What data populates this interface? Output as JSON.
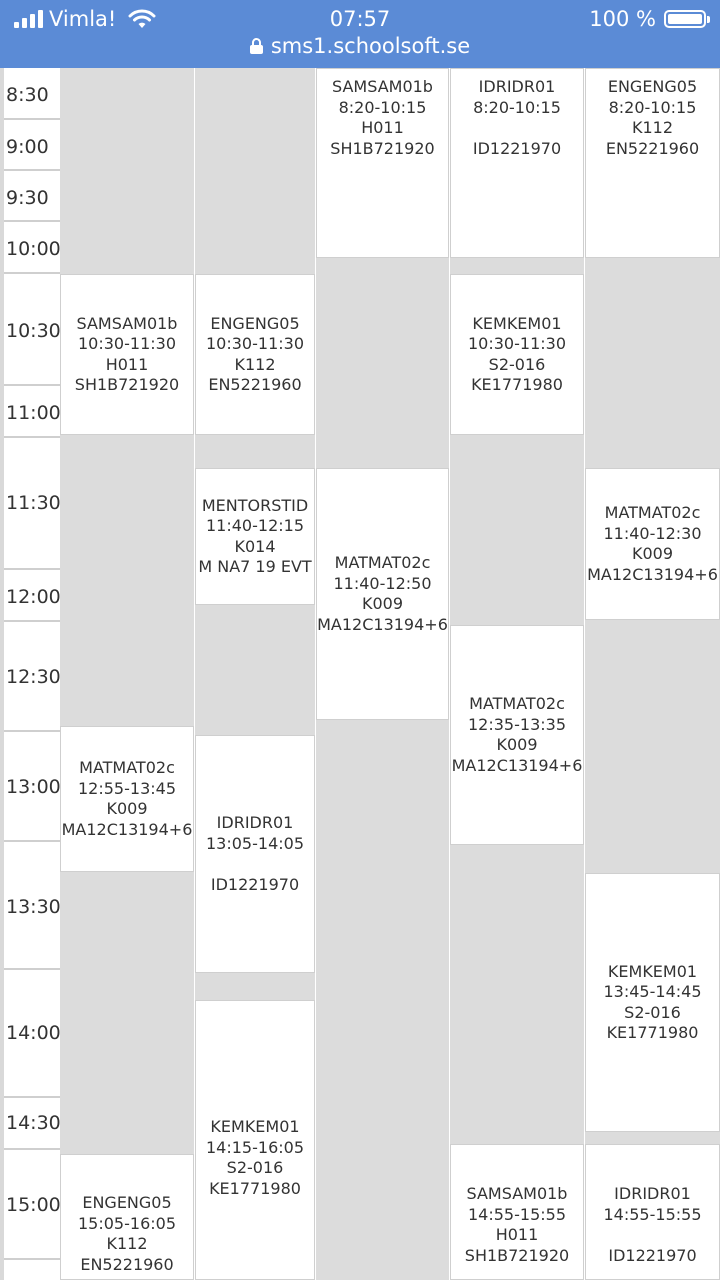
{
  "status_bar": {
    "carrier": "Vimla!",
    "time": "07:57",
    "battery": "100 %",
    "url": "sms1.schoolsoft.se"
  },
  "schedule": {
    "times": [
      "8:30",
      "9:00",
      "9:30",
      "10:00",
      "10:30",
      "11:00",
      "11:30",
      "12:00",
      "12:30",
      "13:00",
      "13:30",
      "14:00",
      "14:30",
      "15:00"
    ],
    "lessons": [
      {
        "course": "SAMSAM01b",
        "time": "8:20-10:15",
        "room": "H011",
        "group": "SH1B721920"
      },
      {
        "course": "IDRIDR01",
        "time": "8:20-10:15",
        "room": "",
        "group": "ID1221970"
      },
      {
        "course": "ENGENG05",
        "time": "8:20-10:15",
        "room": "K112",
        "group": "EN5221960"
      },
      {
        "course": "SAMSAM01b",
        "time": "10:30-11:30",
        "room": "H011",
        "group": "SH1B721920"
      },
      {
        "course": "ENGENG05",
        "time": "10:30-11:30",
        "room": "K112",
        "group": "EN5221960"
      },
      {
        "course": "KEMKEM01",
        "time": "10:30-11:30",
        "room": "S2-016",
        "group": "KE1771980"
      },
      {
        "course": "MENTORSTID",
        "time": "11:40-12:15",
        "room": "K014",
        "group": "M NA7 19 EVT"
      },
      {
        "course": "MATMAT02c",
        "time": "11:40-12:50",
        "room": "K009",
        "group": "MA12C13194+6"
      },
      {
        "course": "MATMAT02c",
        "time": "11:40-12:30",
        "room": "K009",
        "group": "MA12C13194+6"
      },
      {
        "course": "MATMAT02c",
        "time": "12:35-13:35",
        "room": "K009",
        "group": "MA12C13194+6"
      },
      {
        "course": "MATMAT02c",
        "time": "12:55-13:45",
        "room": "K009",
        "group": "MA12C13194+6"
      },
      {
        "course": "IDRIDR01",
        "time": "13:05-14:05",
        "room": "",
        "group": "ID1221970"
      },
      {
        "course": "KEMKEM01",
        "time": "13:45-14:45",
        "room": "S2-016",
        "group": "KE1771980"
      },
      {
        "course": "KEMKEM01",
        "time": "14:15-16:05",
        "room": "S2-016",
        "group": "KE1771980"
      },
      {
        "course": "ENGENG05",
        "time": "15:05-16:05",
        "room": "K112",
        "group": "EN5221960"
      },
      {
        "course": "SAMSAM01b",
        "time": "14:55-15:55",
        "room": "H011",
        "group": "SH1B721920"
      },
      {
        "course": "IDRIDR01",
        "time": "14:55-15:55",
        "room": "",
        "group": "ID1221970"
      }
    ]
  }
}
